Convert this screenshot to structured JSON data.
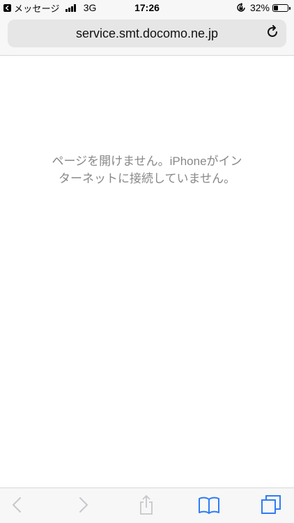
{
  "status_bar": {
    "back_app_label": "メッセージ",
    "network": "3G",
    "time": "17:26",
    "battery_percent": "32%",
    "battery_level": 0.32,
    "icons": [
      "back-arrow-icon",
      "signal-bars-icon",
      "orientation-lock-icon",
      "battery-icon"
    ]
  },
  "address_bar": {
    "url": "service.smt.docomo.ne.jp",
    "reload_icon": "reload-icon"
  },
  "content": {
    "error_line_1": "ページを開けません。iPhoneがイン",
    "error_line_2": "ターネットに接続していません。"
  },
  "toolbar": {
    "items": [
      {
        "name": "back",
        "icon": "chevron-left-icon",
        "enabled": false
      },
      {
        "name": "forward",
        "icon": "chevron-right-icon",
        "enabled": false
      },
      {
        "name": "share",
        "icon": "share-icon",
        "enabled": false
      },
      {
        "name": "bookmarks",
        "icon": "bookmarks-icon",
        "enabled": true
      },
      {
        "name": "tabs",
        "icon": "tabs-icon",
        "enabled": true
      }
    ]
  },
  "colors": {
    "accent": "#2f7cf6",
    "disabled": "#c7c7cc",
    "error_text": "#888888",
    "address_bg": "#e6e6e7"
  }
}
